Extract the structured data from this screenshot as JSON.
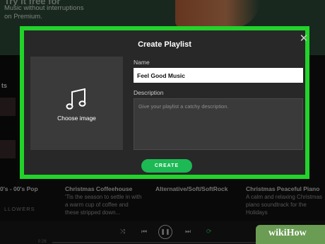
{
  "background": {
    "promo_title_fragment": "Try it free for",
    "promo_line1": "Music without interruptions",
    "promo_line2": "on Premium.",
    "side_label": "ts",
    "row_items": [
      {
        "title": "0's - 00's Pop",
        "desc": ""
      },
      {
        "title": "Christmas Coffeehouse",
        "desc": "'Tis the season to settle in with a warm cup of coffee and these stripped down..."
      },
      {
        "title": "Alternative/Soft/SoftRock",
        "desc": ""
      },
      {
        "title": "Christmas Peaceful Piano",
        "desc": "A calm and relaxing Christmas piano soundtrack for the Holidays"
      }
    ],
    "followers_label": "LLOWERS",
    "time_elapsed": "0:26"
  },
  "modal": {
    "title": "Create Playlist",
    "close_symbol": "✕",
    "choose_image_label": "Choose image",
    "name_label": "Name",
    "name_value": "Feel Good Music",
    "description_label": "Description",
    "description_placeholder": "Give your playlist a catchy description.",
    "create_button_label": "CREATE"
  },
  "colors": {
    "accent_green": "#1db954",
    "highlight_border": "#22d32a",
    "modal_bg": "#282828"
  },
  "icons": [
    "music-note-icon",
    "close-icon",
    "shuffle-icon",
    "previous-icon",
    "pause-icon",
    "next-icon",
    "repeat-icon"
  ],
  "watermark": {
    "text": "wikiHow"
  }
}
